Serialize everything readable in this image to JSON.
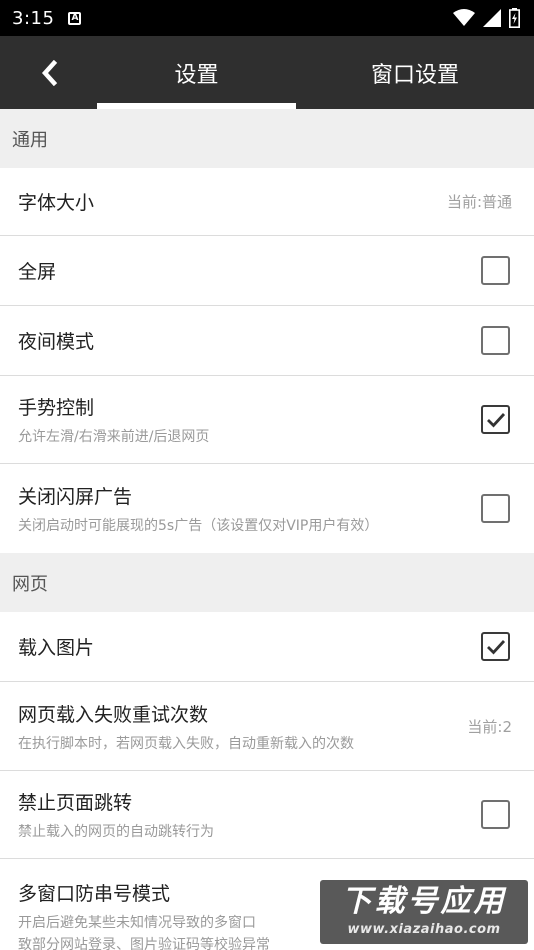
{
  "status_bar": {
    "time": "3:15",
    "notif_letter": "A"
  },
  "app_bar": {
    "tab_settings": "设置",
    "tab_window_settings": "窗口设置"
  },
  "sections": {
    "general": "通用",
    "webpage": "网页"
  },
  "rows": {
    "font_size": {
      "title": "字体大小",
      "value": "当前:普通"
    },
    "fullscreen": {
      "title": "全屏",
      "checked": false
    },
    "night_mode": {
      "title": "夜间模式",
      "checked": false
    },
    "gesture": {
      "title": "手势控制",
      "subtitle": "允许左滑/右滑来前进/后退网页",
      "checked": true
    },
    "splash_ad": {
      "title": "关闭闪屏广告",
      "subtitle": "关闭启动时可能展现的5s广告（该设置仅对VIP用户有效）",
      "checked": false
    },
    "load_images": {
      "title": "载入图片",
      "checked": true
    },
    "retry": {
      "title": "网页载入失败重试次数",
      "subtitle": "在执行脚本时，若网页载入失败，自动重新载入的次数",
      "value": "当前:2"
    },
    "no_redirect": {
      "title": "禁止页面跳转",
      "subtitle": "禁止载入的网页的自动跳转行为",
      "checked": false
    },
    "multi_window": {
      "title": "多窗口防串号模式",
      "subtitle_1": "开启后避免某些未知情况导致的多窗口",
      "subtitle_2": "致部分网站登录、图片验证码等校验异常"
    }
  },
  "watermark": {
    "main": "下载号应用",
    "sub": "www.xiazaihao.com"
  }
}
